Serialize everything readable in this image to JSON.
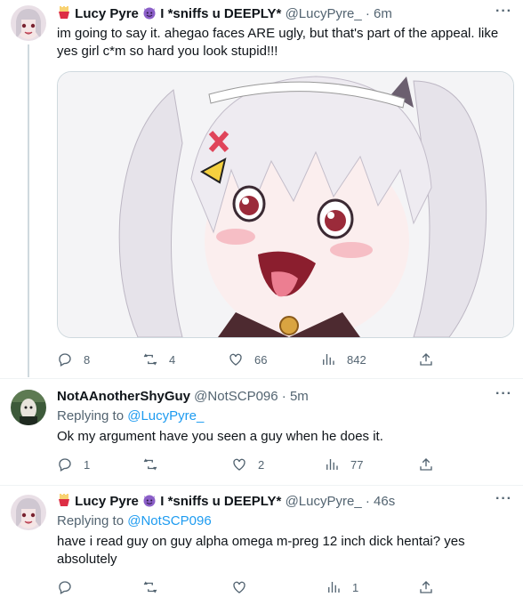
{
  "tweets": [
    {
      "display_name": "Lucy Pyre",
      "name_suffix": "I *sniffs u DEEPLY*",
      "handle": "@LucyPyre_",
      "time": "6m",
      "text": "im going to say it. ahegao faces ARE ugly, but that's part of the appeal. like yes girl c*m so hard you look stupid!!!",
      "media": true,
      "replies": "8",
      "retweets": "4",
      "likes": "66",
      "views": "842"
    },
    {
      "display_name": "NotAAnotherShyGuy",
      "handle": "@NotSCP096",
      "time": "5m",
      "replying_label": "Replying to",
      "replying_handle": "@LucyPyre_",
      "text": "Ok my argument have you seen a guy when he does it.",
      "replies": "1",
      "retweets": "",
      "likes": "2",
      "views": "77"
    },
    {
      "display_name": "Lucy Pyre",
      "name_suffix": "I *sniffs u DEEPLY*",
      "handle": "@LucyPyre_",
      "time": "46s",
      "replying_label": "Replying to",
      "replying_handle": "@NotSCP096",
      "text": "have i read guy on guy alpha omega m-preg 12 inch dick hentai? yes absolutely",
      "replies": "",
      "retweets": "",
      "likes": "",
      "views": "1"
    }
  ],
  "separator": "·",
  "icons": {
    "reply": "reply-icon",
    "retweet": "retweet-icon",
    "like": "heart-icon",
    "views": "views-icon",
    "share": "share-icon",
    "more": "more-icon"
  },
  "colors": {
    "link": "#1d9bf0",
    "secondary_text": "#536471",
    "divider": "#eff3f4"
  }
}
